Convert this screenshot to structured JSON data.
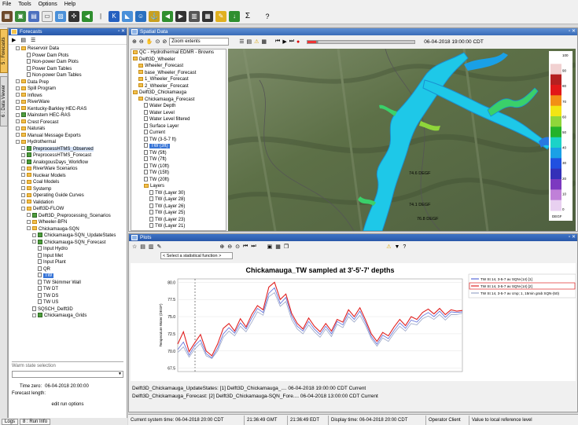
{
  "menu": [
    "File",
    "Tools",
    "Options",
    "Help"
  ],
  "vtabs": {
    "forecasts": "5 : Forecasts",
    "data_viewer": "6 : Data Viewer"
  },
  "forecasts_panel": {
    "title": "Forecasts",
    "tree": [
      {
        "label": "Reservoir Data",
        "indent": 1,
        "kind": "fold"
      },
      {
        "label": "Power Dam Plots",
        "indent": 3,
        "kind": "doc"
      },
      {
        "label": "Non-power Dam Plots",
        "indent": 3,
        "kind": "doc"
      },
      {
        "label": "Power Dam Tables",
        "indent": 3,
        "kind": "doc"
      },
      {
        "label": "Non-power Dam Tables",
        "indent": 3,
        "kind": "doc"
      },
      {
        "label": "Data Prep",
        "indent": 1,
        "kind": "fold"
      },
      {
        "label": "Spill Program",
        "indent": 1,
        "kind": "fold"
      },
      {
        "label": "Inflows",
        "indent": 1,
        "kind": "fold"
      },
      {
        "label": "RiverWare",
        "indent": 1,
        "kind": "fold"
      },
      {
        "label": "Kentucky-Barkley HEC-RAS",
        "indent": 1,
        "kind": "fold"
      },
      {
        "label": "Mainstem HEC-RAS",
        "indent": 1,
        "kind": "chk"
      },
      {
        "label": "Crest Forecast",
        "indent": 1,
        "kind": "fold"
      },
      {
        "label": "Naturals",
        "indent": 1,
        "kind": "fold"
      },
      {
        "label": "Manual Message Exports",
        "indent": 1,
        "kind": "fold"
      },
      {
        "label": "Hydrothermal",
        "indent": 1,
        "kind": "fold"
      },
      {
        "label": "PreprocessHTMS_Observed",
        "indent": 2,
        "kind": "chk",
        "hl": true
      },
      {
        "label": "PreprocessHTMS_Forecast",
        "indent": 2,
        "kind": "chk"
      },
      {
        "label": "AnalogousDays_Workflow",
        "indent": 2,
        "kind": "chk"
      },
      {
        "label": "RiverWare Scenarios",
        "indent": 2,
        "kind": "fold"
      },
      {
        "label": "Nuclear Models",
        "indent": 2,
        "kind": "fold"
      },
      {
        "label": "Coal Models",
        "indent": 2,
        "kind": "fold"
      },
      {
        "label": "Systemp",
        "indent": 2,
        "kind": "fold"
      },
      {
        "label": "Operating Guide Curves",
        "indent": 2,
        "kind": "fold"
      },
      {
        "label": "Validation",
        "indent": 2,
        "kind": "fold"
      },
      {
        "label": "Delft3D-FLOW",
        "indent": 2,
        "kind": "fold"
      },
      {
        "label": "Delft3D_Preprocessing_Scenarios",
        "indent": 3,
        "kind": "chk"
      },
      {
        "label": "Wheeler-BFN",
        "indent": 3,
        "kind": "fold"
      },
      {
        "label": "Chickamauga-SQN",
        "indent": 3,
        "kind": "fold"
      },
      {
        "label": "Chickamauga-SQN_UpdateStates",
        "indent": 4,
        "kind": "chk"
      },
      {
        "label": "Chickamauga-SQN_Forecast",
        "indent": 4,
        "kind": "chk"
      },
      {
        "label": "Input Hydro",
        "indent": 5,
        "kind": "doc"
      },
      {
        "label": "Input Met",
        "indent": 5,
        "kind": "doc"
      },
      {
        "label": "Input Plant",
        "indent": 5,
        "kind": "doc"
      },
      {
        "label": "QR",
        "indent": 5,
        "kind": "doc"
      },
      {
        "label": "TW",
        "indent": 5,
        "kind": "doc",
        "sel": true
      },
      {
        "label": "TW Skimmer Wall",
        "indent": 5,
        "kind": "doc"
      },
      {
        "label": "TW DT",
        "indent": 5,
        "kind": "doc"
      },
      {
        "label": "TW DS",
        "indent": 5,
        "kind": "doc"
      },
      {
        "label": "TW US",
        "indent": 5,
        "kind": "doc"
      },
      {
        "label": "SQSCH_Delft3D",
        "indent": 4,
        "kind": "doc"
      },
      {
        "label": "Chickamauga_Grids",
        "indent": 4,
        "kind": "chk"
      }
    ],
    "warm_state_label": "Warm state selection",
    "time_zero_label": "Time zero:",
    "time_zero_value": "06-04-2018 20:00:00",
    "forecast_length_label": "Forecast length:",
    "edit_run_options": "edit run options"
  },
  "bottom_tabs": [
    "Logs",
    "8 : Run Info"
  ],
  "scenario_panel": {
    "title": "Spatial Data",
    "zoom_select": "Zoom extents",
    "datetime": "06-04-2018 19:00:00 CDT",
    "tree": [
      {
        "label": "QC - Hydrothermal EDMR - Browns",
        "indent": 0
      },
      {
        "label": "Delft3D_Wheeler",
        "indent": 0
      },
      {
        "label": "Wheeler_Forecast",
        "indent": 1
      },
      {
        "label": "base_Wheeler_Forecast",
        "indent": 1
      },
      {
        "label": "1_Wheeler_Forecast",
        "indent": 1
      },
      {
        "label": "2_Wheeler_Forecast",
        "indent": 1
      },
      {
        "label": "Delft3D_Chickamauga",
        "indent": 0
      },
      {
        "label": "Chickamauga_Forecast",
        "indent": 1
      },
      {
        "label": "Water Depth",
        "indent": 2
      },
      {
        "label": "Water Level",
        "indent": 2
      },
      {
        "label": "Water Level filtered",
        "indent": 2
      },
      {
        "label": "Surface Layer",
        "indent": 2
      },
      {
        "label": "Current",
        "indent": 2
      },
      {
        "label": "TW (3-5-7 ft)",
        "indent": 2
      },
      {
        "label": "TW (3ft)",
        "indent": 2,
        "sel": true
      },
      {
        "label": "TW (5ft)",
        "indent": 2
      },
      {
        "label": "TW (7ft)",
        "indent": 2
      },
      {
        "label": "TW (10ft)",
        "indent": 2
      },
      {
        "label": "TW (15ft)",
        "indent": 2
      },
      {
        "label": "TW (20ft)",
        "indent": 2
      },
      {
        "label": "Layers",
        "indent": 2
      },
      {
        "label": "TW (Layer 30)",
        "indent": 3
      },
      {
        "label": "TW (Layer 28)",
        "indent": 3
      },
      {
        "label": "TW (Layer 26)",
        "indent": 3
      },
      {
        "label": "TW (Layer 25)",
        "indent": 3
      },
      {
        "label": "TW (Layer 23)",
        "indent": 3
      },
      {
        "label": "TW (Layer 21)",
        "indent": 3
      }
    ],
    "map_labels": [
      "74.6 DEGF",
      "74.1 DEGF",
      "76.8 DEGF"
    ],
    "legend_ticks": [
      "100",
      "90",
      "80",
      "70",
      "60",
      "50",
      "40",
      "30",
      "20",
      "10",
      "0"
    ],
    "legend_unit": "DEGF",
    "legend_colors": [
      "#ffffff",
      "#f1d1d1",
      "#b52020",
      "#e21818",
      "#f28f16",
      "#f2e514",
      "#8fd63a",
      "#23b22a",
      "#1bd3c8",
      "#1aa0e6",
      "#2050e0",
      "#3430b8",
      "#7c39c0",
      "#c080d8",
      "#e8d0f0"
    ]
  },
  "plots_panel": {
    "title": "Plots",
    "stat_select": "< Select a statistical function >",
    "info_lines": [
      "Delft3D_Chickamauga_UpdateStates: [1] Delft3D_Chickamauga_.... 06-04-2018 19:00:00 CDT Current",
      "Delft3D_Chickamauga_Forecast: [2] Delft3D_Chickamauga-SQN_Fore.... 06-04-2018 13:00:00 CDT Current"
    ]
  },
  "chart_data": {
    "type": "line",
    "title": "Chickamauga_TW sampled at 3'-5'-7' depths",
    "ylabel": "Temperature Water (DEGF)",
    "ylim": [
      67,
      80.5
    ],
    "yticks": [
      "80.0",
      "77.5",
      "75.0",
      "72.5",
      "70.0",
      "67.5"
    ],
    "x": [
      0,
      2,
      4,
      6,
      8,
      10,
      12,
      14,
      16,
      18,
      20,
      22,
      24,
      26,
      28,
      30,
      32,
      34,
      36,
      38,
      40,
      42,
      44,
      46,
      48,
      50,
      52,
      54,
      56,
      58,
      60,
      62,
      64,
      66,
      68,
      70,
      72,
      74,
      76,
      78,
      80,
      82,
      84,
      86,
      88,
      90,
      92,
      94,
      96,
      98,
      100
    ],
    "series": [
      {
        "name": "TW St 14, 3-5-7 av SQN-(14) [1]",
        "color": "#5a6ad8",
        "values": [
          70.2,
          71.3,
          69.4,
          70.8,
          71.6,
          69.6,
          69.0,
          70.4,
          72.5,
          73.4,
          72.6,
          74.1,
          73.2,
          74.8,
          76.2,
          75.6,
          78.4,
          79.2,
          76.9,
          77.8,
          75.1,
          73.6,
          72.9,
          74.3,
          73.2,
          72.4,
          73.6,
          72.5,
          74.3,
          73.8,
          75.5,
          74.6,
          75.8,
          74.1,
          72.1,
          71.0,
          72.3,
          71.8,
          73.0,
          74.1,
          73.3,
          74.5,
          74.2,
          75.1,
          75.6,
          75.0,
          75.8,
          74.9,
          75.7,
          75.6,
          75.7
        ]
      },
      {
        "name": "TW St 14, 3-5-7 av SQN-(14) [2]",
        "color": "#e02020",
        "values": [
          71.0,
          72.8,
          69.9,
          71.2,
          72.4,
          70.0,
          69.3,
          71.0,
          73.3,
          74.0,
          72.9,
          74.7,
          73.5,
          75.3,
          76.6,
          76.0,
          79.3,
          80.0,
          77.5,
          78.3,
          75.5,
          74.0,
          73.2,
          74.8,
          73.6,
          72.8,
          74.0,
          72.9,
          74.6,
          74.2,
          76.0,
          75.0,
          76.3,
          74.5,
          72.5,
          71.4,
          72.7,
          72.2,
          73.5,
          74.6,
          73.7,
          75.0,
          74.6,
          75.6,
          76.1,
          75.4,
          76.2,
          75.3,
          76.0,
          75.8,
          75.9
        ]
      },
      {
        "name": "TW St 14, 3-5-7 av cmp; 1, 15min grab SQN-(50)",
        "color": "#9aa6c8",
        "values": [
          69.8,
          70.6,
          69.1,
          70.3,
          71.1,
          69.3,
          68.9,
          70.0,
          72.0,
          72.9,
          72.2,
          73.6,
          72.8,
          74.2,
          75.7,
          75.2,
          77.9,
          78.5,
          76.5,
          77.2,
          74.6,
          73.2,
          72.5,
          73.8,
          72.8,
          72.0,
          73.2,
          72.1,
          73.9,
          73.4,
          75.0,
          74.2,
          75.2,
          73.7,
          71.8,
          70.7,
          71.9,
          71.4,
          72.6,
          73.6,
          72.9,
          74.0,
          73.8,
          74.7,
          75.1,
          74.6,
          75.3,
          74.5,
          75.3,
          75.3,
          75.5
        ]
      }
    ],
    "legend_position": "top-right"
  },
  "statusbar": [
    "Current system time: 06-04-2018 20:00 CDT",
    "21:36:49 GMT",
    "21:36:49 EDT",
    "Display time: 06-04-2018 20:00 CDT",
    "Operator Client",
    "Value to local reference level"
  ]
}
